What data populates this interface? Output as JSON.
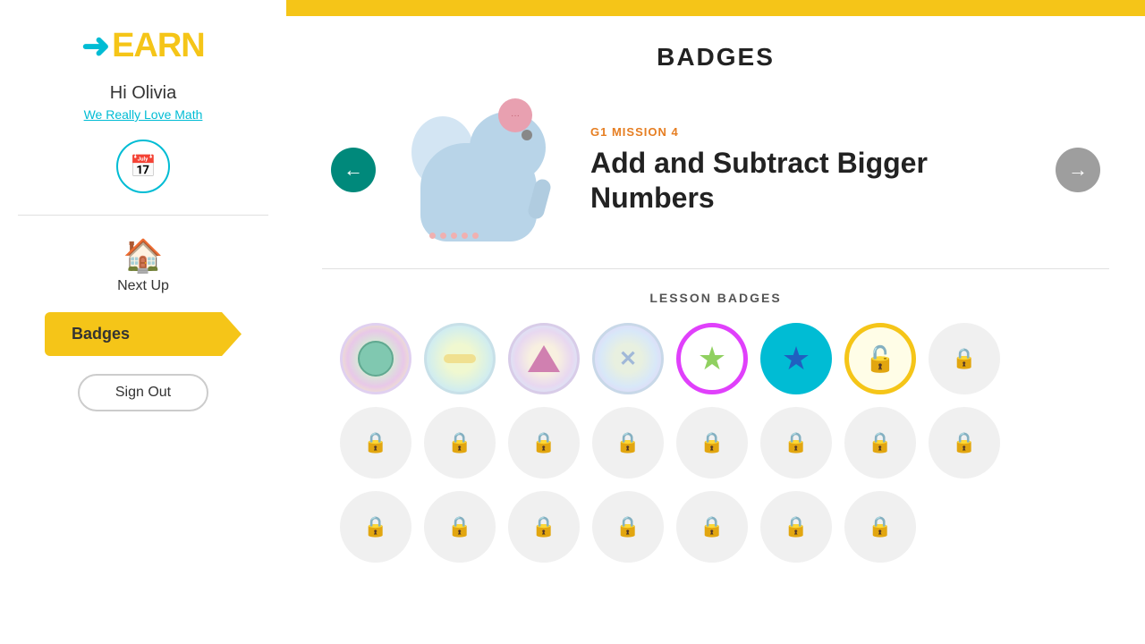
{
  "sidebar": {
    "logo_arrow": "➜",
    "logo_text": "EARN",
    "greeting": "Hi Olivia",
    "class_name": "We Really Love Math",
    "next_up_label": "Next Up",
    "badges_button": "Badges",
    "signout_button": "Sign Out"
  },
  "main": {
    "page_title": "BADGES",
    "top_bar_color": "#f5c518",
    "mission": {
      "label": "G1 MISSION 4",
      "title": "Add and Subtract Bigger Numbers"
    },
    "lesson_badges_title": "LESSON BADGES"
  },
  "badges": {
    "row1": [
      {
        "type": "earned-1"
      },
      {
        "type": "earned-2"
      },
      {
        "type": "earned-3"
      },
      {
        "type": "earned-4"
      },
      {
        "type": "earned-5"
      },
      {
        "type": "earned-6"
      },
      {
        "type": "earned-7"
      },
      {
        "type": "locked"
      }
    ],
    "row2": [
      {
        "type": "locked"
      },
      {
        "type": "locked"
      },
      {
        "type": "locked"
      },
      {
        "type": "locked"
      },
      {
        "type": "locked"
      },
      {
        "type": "locked"
      },
      {
        "type": "locked"
      },
      {
        "type": "locked"
      }
    ],
    "row3": [
      {
        "type": "locked"
      },
      {
        "type": "locked"
      },
      {
        "type": "locked"
      },
      {
        "type": "locked"
      },
      {
        "type": "locked"
      },
      {
        "type": "locked"
      },
      {
        "type": "locked"
      }
    ]
  }
}
